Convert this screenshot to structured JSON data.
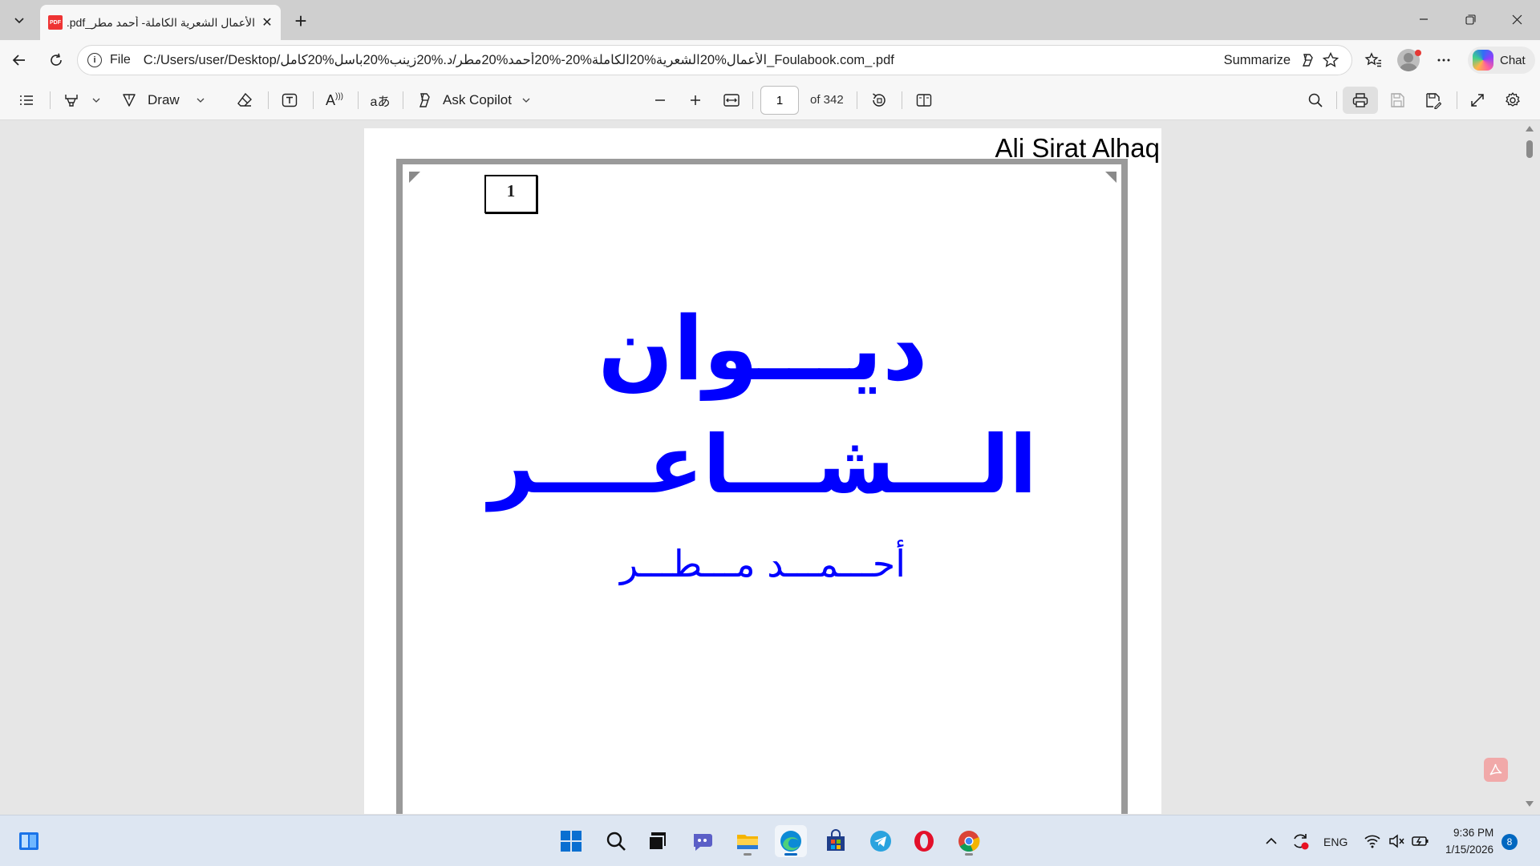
{
  "browser": {
    "tab": {
      "title": "الأعمال الشعرية الكاملة- أحمد مطر_Ali Sirat Alhaq.pdf",
      "close_glyph": "✕"
    },
    "new_tab_glyph": "+",
    "window_controls": {
      "minimize": "—",
      "restore": "❐",
      "close": "✕"
    },
    "address": {
      "scheme": "File",
      "url": "C:/Users/user/Desktop/الأعمال%20الشعرية%20الكاملة%20-%20أحمد%20مطر/د.%20زينب%20باسل%20كامل_Foulabook.com_.pdf",
      "summarize": "Summarize"
    },
    "chat_label": "Chat"
  },
  "pdf_toolbar": {
    "draw_label": "Draw",
    "ask_copilot_label": "Ask Copilot",
    "current_page": "1",
    "page_total": "of 342",
    "read_aloud_glyph": "A",
    "translate_glyph": "aあ"
  },
  "document": {
    "watermark": "Ali Sirat Alhaq",
    "page_number": "1",
    "title_line1": "ديـــوان",
    "title_line2": "الـــشـــاعــــر",
    "author": "أحـــمـــد مـــطـــر"
  },
  "taskbar": {
    "language": "ENG",
    "time": "9:36 PM",
    "date": "1/15/2026",
    "notification_count": "8"
  },
  "colors": {
    "title_blue": "#0000ff",
    "frame_gray": "#9a9a9a",
    "accent": "#0067c0"
  }
}
